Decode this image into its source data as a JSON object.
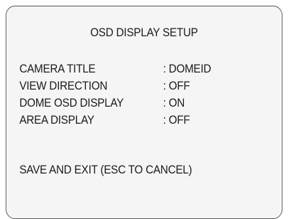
{
  "osd": {
    "title": "OSD DISPLAY SETUP",
    "items": [
      {
        "label": "CAMERA TITLE",
        "value": ": DOMEID"
      },
      {
        "label": "VIEW DIRECTION",
        "value": ": OFF"
      },
      {
        "label": "DOME OSD DISPLAY",
        "value": ": ON"
      },
      {
        "label": "AREA DISPLAY",
        "value": ": OFF"
      }
    ],
    "save_exit": "SAVE AND EXIT (ESC TO CANCEL)"
  }
}
